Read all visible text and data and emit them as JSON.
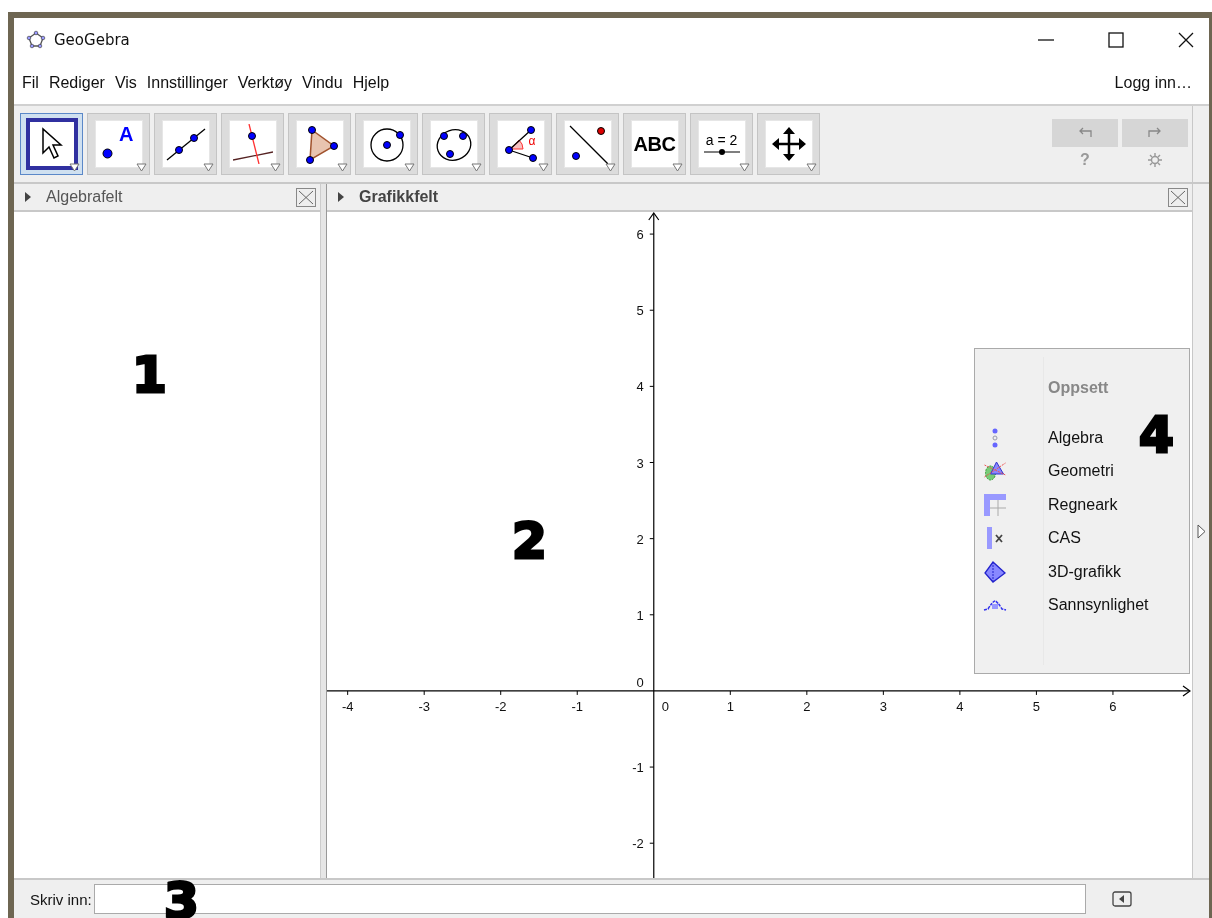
{
  "window": {
    "title": "GeoGebra"
  },
  "menu": [
    "Fil",
    "Rediger",
    "Vis",
    "Innstillinger",
    "Verktøy",
    "Vindu",
    "Hjelp"
  ],
  "login": "Logg inn…",
  "tools": [
    {
      "kind": "move",
      "selected": true
    },
    {
      "kind": "point",
      "label": "A",
      "selected": false
    },
    {
      "kind": "line",
      "selected": false
    },
    {
      "kind": "perpendicular",
      "selected": false
    },
    {
      "kind": "polygon",
      "selected": false
    },
    {
      "kind": "circle",
      "selected": false
    },
    {
      "kind": "conic",
      "selected": false
    },
    {
      "kind": "angle",
      "label": "α",
      "selected": false
    },
    {
      "kind": "reflect",
      "selected": false
    },
    {
      "kind": "text",
      "label": "ABC",
      "selected": false
    },
    {
      "kind": "slider",
      "label": "a = 2",
      "selected": false
    },
    {
      "kind": "pan",
      "selected": false
    }
  ],
  "undo": {
    "disabled": true
  },
  "redo": {
    "disabled": true
  },
  "help": "?",
  "algebra_view": {
    "title": "Algebrafelt"
  },
  "graphics_view": {
    "title": "Grafikkfelt",
    "origin_labels": [
      "0",
      "0"
    ],
    "chart_data": {
      "type": "line",
      "xlim": [
        -4.27,
        7.02
      ],
      "ylim": [
        -2.47,
        6.29
      ],
      "xticks": [
        -4,
        -3,
        -2,
        -1,
        1,
        2,
        3,
        4,
        5,
        6
      ],
      "yticks": [
        -2,
        -1,
        1,
        2,
        3,
        4,
        5,
        6
      ]
    }
  },
  "perspectives": {
    "title": "Oppsett",
    "items": [
      {
        "kind": "algebra",
        "label": "Algebra"
      },
      {
        "kind": "geometry",
        "label": "Geometri"
      },
      {
        "kind": "spreadsheet",
        "label": "Regneark"
      },
      {
        "kind": "cas",
        "label": "CAS"
      },
      {
        "kind": "solid",
        "label": "3D-grafikk"
      },
      {
        "kind": "probability",
        "label": "Sannsynlighet"
      }
    ]
  },
  "input_bar": {
    "label": "Skriv inn:"
  },
  "annotations": [
    "1",
    "2",
    "3",
    "4"
  ]
}
